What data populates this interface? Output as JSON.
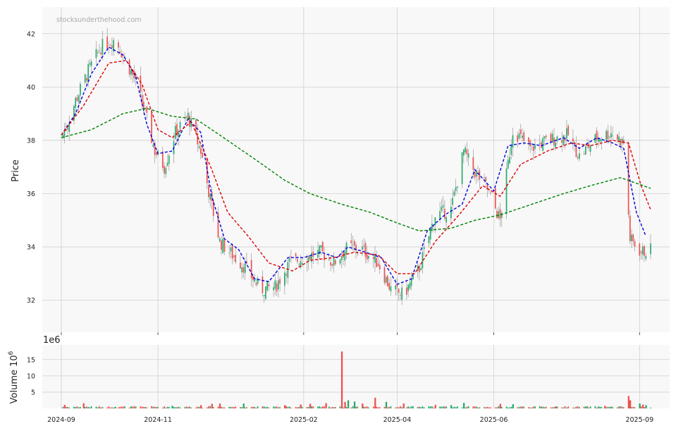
{
  "watermark": "stocksunderthehood.com",
  "colors": {
    "up": "#26a96c",
    "down": "#ef4f4f",
    "ma_fast": "#0000dd",
    "ma_mid": "#e00000",
    "ma_slow": "#008000",
    "panel_bg": "#f8f8f8",
    "grid": "#d0d0d0"
  },
  "chart_data": [
    {
      "type": "candlestick",
      "ylabel": "Price",
      "ylim": [
        30.8,
        43.0
      ],
      "yticks": [
        32,
        34,
        36,
        38,
        40,
        42
      ],
      "grid": true,
      "x_ticks": [
        {
          "date": "2024-09-01",
          "label": "2024-09"
        },
        {
          "date": "2024-11-01",
          "label": "2024-11"
        },
        {
          "date": "2025-02-01",
          "label": "2025-02"
        },
        {
          "date": "2025-04-01",
          "label": "2025-04"
        },
        {
          "date": "2025-06-01",
          "label": "2025-06"
        },
        {
          "date": "2025-09-01",
          "label": "2025-09"
        }
      ],
      "xlim": [
        "2024-08-20",
        "2025-09-20"
      ],
      "price_anchors": [
        [
          "2024-09-01",
          38.1
        ],
        [
          "2024-09-05",
          38.6
        ],
        [
          "2024-09-10",
          39.5
        ],
        [
          "2024-09-18",
          40.6
        ],
        [
          "2024-09-26",
          41.5
        ],
        [
          "2024-10-05",
          41.8
        ],
        [
          "2024-10-10",
          41.2
        ],
        [
          "2024-10-18",
          40.2
        ],
        [
          "2024-10-24",
          39.0
        ],
        [
          "2024-10-30",
          37.6
        ],
        [
          "2024-11-05",
          37.0
        ],
        [
          "2024-11-12",
          38.3
        ],
        [
          "2024-11-20",
          38.9
        ],
        [
          "2024-11-28",
          37.6
        ],
        [
          "2024-12-04",
          35.8
        ],
        [
          "2024-12-10",
          34.2
        ],
        [
          "2024-12-18",
          33.7
        ],
        [
          "2024-12-25",
          33.3
        ],
        [
          "2025-01-05",
          32.4
        ],
        [
          "2025-01-14",
          32.5
        ],
        [
          "2025-01-23",
          33.4
        ],
        [
          "2025-02-01",
          33.6
        ],
        [
          "2025-02-12",
          33.8
        ],
        [
          "2025-02-20",
          33.4
        ],
        [
          "2025-03-01",
          34.0
        ],
        [
          "2025-03-10",
          33.9
        ],
        [
          "2025-03-20",
          33.4
        ],
        [
          "2025-03-28",
          32.4
        ],
        [
          "2025-04-05",
          32.2
        ],
        [
          "2025-04-15",
          33.2
        ],
        [
          "2025-04-25",
          35.2
        ],
        [
          "2025-05-05",
          35.4
        ],
        [
          "2025-05-13",
          37.6
        ],
        [
          "2025-05-20",
          36.8
        ],
        [
          "2025-05-27",
          36.3
        ],
        [
          "2025-06-05",
          35.0
        ],
        [
          "2025-06-13",
          38.4
        ],
        [
          "2025-06-24",
          37.7
        ],
        [
          "2025-07-05",
          38.0
        ],
        [
          "2025-07-18",
          38.2
        ],
        [
          "2025-07-25",
          37.4
        ],
        [
          "2025-08-05",
          38.1
        ],
        [
          "2025-08-14",
          38.3
        ],
        [
          "2025-08-22",
          37.9
        ],
        [
          "2025-08-26",
          34.3
        ],
        [
          "2025-09-02",
          33.8
        ],
        [
          "2025-09-08",
          33.9
        ]
      ],
      "series": [
        {
          "style": "dashed",
          "color": "#0000dd",
          "points": [
            [
              "2024-09-01",
              38.2
            ],
            [
              "2024-09-10",
              39.0
            ],
            [
              "2024-09-20",
              40.5
            ],
            [
              "2024-10-01",
              41.5
            ],
            [
              "2024-10-10",
              41.2
            ],
            [
              "2024-10-18",
              40.4
            ],
            [
              "2024-10-25",
              38.6
            ],
            [
              "2024-11-01",
              37.5
            ],
            [
              "2024-11-10",
              37.6
            ],
            [
              "2024-11-20",
              38.8
            ],
            [
              "2024-11-28",
              38.3
            ],
            [
              "2024-12-05",
              35.9
            ],
            [
              "2024-12-13",
              34.3
            ],
            [
              "2024-12-22",
              33.9
            ],
            [
              "2025-01-01",
              32.8
            ],
            [
              "2025-01-10",
              32.7
            ],
            [
              "2025-01-22",
              33.6
            ],
            [
              "2025-02-01",
              33.6
            ],
            [
              "2025-02-12",
              33.8
            ],
            [
              "2025-02-22",
              33.6
            ],
            [
              "2025-03-01",
              34.0
            ],
            [
              "2025-03-12",
              33.8
            ],
            [
              "2025-03-22",
              33.6
            ],
            [
              "2025-04-01",
              32.6
            ],
            [
              "2025-04-10",
              32.8
            ],
            [
              "2025-04-20",
              34.6
            ],
            [
              "2025-05-01",
              35.2
            ],
            [
              "2025-05-12",
              35.6
            ],
            [
              "2025-05-20",
              36.9
            ],
            [
              "2025-06-01",
              36.1
            ],
            [
              "2025-06-10",
              37.8
            ],
            [
              "2025-06-20",
              37.9
            ],
            [
              "2025-07-01",
              37.8
            ],
            [
              "2025-07-15",
              38.1
            ],
            [
              "2025-07-25",
              37.7
            ],
            [
              "2025-08-05",
              38.1
            ],
            [
              "2025-08-15",
              37.9
            ],
            [
              "2025-08-22",
              37.7
            ],
            [
              "2025-08-30",
              35.3
            ],
            [
              "2025-09-05",
              34.4
            ]
          ]
        },
        {
          "style": "dashed",
          "color": "#e00000",
          "points": [
            [
              "2024-09-01",
              38.2
            ],
            [
              "2024-09-15",
              39.3
            ],
            [
              "2024-10-01",
              40.9
            ],
            [
              "2024-10-12",
              41.0
            ],
            [
              "2024-10-22",
              40.1
            ],
            [
              "2024-11-01",
              38.4
            ],
            [
              "2024-11-10",
              38.1
            ],
            [
              "2024-11-22",
              38.7
            ],
            [
              "2024-12-05",
              36.9
            ],
            [
              "2024-12-15",
              35.3
            ],
            [
              "2024-12-28",
              34.4
            ],
            [
              "2025-01-10",
              33.4
            ],
            [
              "2025-01-25",
              33.1
            ],
            [
              "2025-02-05",
              33.5
            ],
            [
              "2025-02-20",
              33.6
            ],
            [
              "2025-03-05",
              33.8
            ],
            [
              "2025-03-20",
              33.7
            ],
            [
              "2025-04-01",
              33.0
            ],
            [
              "2025-04-12",
              33.0
            ],
            [
              "2025-04-25",
              34.2
            ],
            [
              "2025-05-10",
              35.2
            ],
            [
              "2025-05-25",
              36.3
            ],
            [
              "2025-06-05",
              35.9
            ],
            [
              "2025-06-18",
              37.1
            ],
            [
              "2025-07-05",
              37.6
            ],
            [
              "2025-07-20",
              37.9
            ],
            [
              "2025-08-01",
              37.8
            ],
            [
              "2025-08-15",
              38.0
            ],
            [
              "2025-08-25",
              37.9
            ],
            [
              "2025-09-02",
              36.3
            ],
            [
              "2025-09-08",
              35.4
            ]
          ]
        },
        {
          "style": "dashed",
          "color": "#008000",
          "points": [
            [
              "2024-09-01",
              38.1
            ],
            [
              "2024-09-20",
              38.4
            ],
            [
              "2024-10-10",
              39.0
            ],
            [
              "2024-10-25",
              39.2
            ],
            [
              "2024-11-10",
              38.9
            ],
            [
              "2024-11-25",
              38.8
            ],
            [
              "2024-12-10",
              38.2
            ],
            [
              "2025-01-01",
              37.3
            ],
            [
              "2025-01-20",
              36.5
            ],
            [
              "2025-02-05",
              36.0
            ],
            [
              "2025-02-25",
              35.6
            ],
            [
              "2025-03-15",
              35.3
            ],
            [
              "2025-04-01",
              34.9
            ],
            [
              "2025-04-15",
              34.6
            ],
            [
              "2025-05-05",
              34.7
            ],
            [
              "2025-05-20",
              35.0
            ],
            [
              "2025-06-05",
              35.2
            ],
            [
              "2025-06-25",
              35.6
            ],
            [
              "2025-07-15",
              36.0
            ],
            [
              "2025-08-01",
              36.3
            ],
            [
              "2025-08-20",
              36.6
            ],
            [
              "2025-09-08",
              36.2
            ]
          ]
        }
      ]
    },
    {
      "type": "bar",
      "ylabel": "Volume  10",
      "ylabel_exp": "6",
      "offset_text": "1e6",
      "ylim": [
        0,
        19.5
      ],
      "yticks": [
        5,
        10,
        15
      ],
      "grid": true,
      "baseline_millions": 0.5,
      "spikes": [
        [
          "2024-09-03",
          1.1,
          "down"
        ],
        [
          "2024-09-15",
          1.6,
          "down"
        ],
        [
          "2024-10-05",
          0.5,
          "up"
        ],
        [
          "2024-11-10",
          0.8,
          "up"
        ],
        [
          "2024-11-28",
          1.0,
          "down"
        ],
        [
          "2024-12-05",
          1.4,
          "down"
        ],
        [
          "2024-12-10",
          1.5,
          "down"
        ],
        [
          "2024-12-25",
          1.5,
          "up"
        ],
        [
          "2025-01-20",
          1.0,
          "down"
        ],
        [
          "2025-01-30",
          1.2,
          "down"
        ],
        [
          "2025-02-05",
          1.4,
          "down"
        ],
        [
          "2025-02-15",
          1.6,
          "down"
        ],
        [
          "2025-02-25",
          17.5,
          "down"
        ],
        [
          "2025-02-27",
          2.0,
          "down"
        ],
        [
          "2025-03-01",
          2.5,
          "up"
        ],
        [
          "2025-03-05",
          2.1,
          "up"
        ],
        [
          "2025-03-10",
          1.5,
          "down"
        ],
        [
          "2025-03-18",
          3.3,
          "down"
        ],
        [
          "2025-03-25",
          2.0,
          "up"
        ],
        [
          "2025-04-05",
          1.5,
          "down"
        ],
        [
          "2025-04-25",
          1.1,
          "down"
        ],
        [
          "2025-05-05",
          1.0,
          "up"
        ],
        [
          "2025-05-13",
          1.7,
          "up"
        ],
        [
          "2025-06-05",
          1.4,
          "down"
        ],
        [
          "2025-06-13",
          1.3,
          "up"
        ],
        [
          "2025-07-10",
          0.6,
          "down"
        ],
        [
          "2025-08-10",
          0.8,
          "down"
        ],
        [
          "2025-08-25",
          3.8,
          "down"
        ],
        [
          "2025-08-26",
          2.5,
          "down"
        ],
        [
          "2025-09-01",
          1.5,
          "up"
        ],
        [
          "2025-09-03",
          1.2,
          "down"
        ],
        [
          "2025-09-05",
          1.0,
          "up"
        ]
      ]
    }
  ]
}
